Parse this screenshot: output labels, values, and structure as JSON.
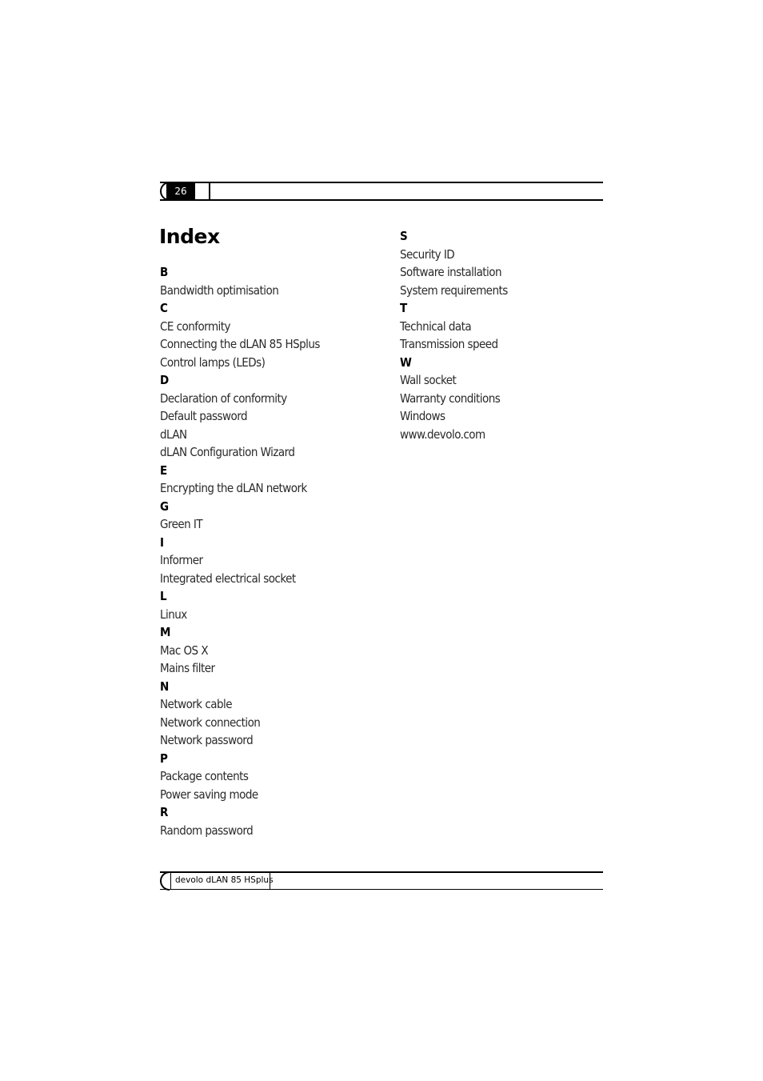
{
  "header": {
    "page_number": "26"
  },
  "title": "Index",
  "index": {
    "left_column": [
      {
        "letter": "B",
        "entries": [
          "Bandwidth optimisation"
        ]
      },
      {
        "letter": "C",
        "entries": [
          "CE conformity",
          "Connecting the dLAN 85 HSplus",
          "Control lamps (LEDs)"
        ]
      },
      {
        "letter": "D",
        "entries": [
          "Declaration of conformity",
          "Default password",
          "dLAN",
          "dLAN Configuration Wizard"
        ]
      },
      {
        "letter": "E",
        "entries": [
          "Encrypting the dLAN network"
        ]
      },
      {
        "letter": "G",
        "entries": [
          "Green IT"
        ]
      },
      {
        "letter": "I",
        "entries": [
          "Informer",
          "Integrated electrical socket"
        ]
      },
      {
        "letter": "L",
        "entries": [
          "Linux"
        ]
      },
      {
        "letter": "M",
        "entries": [
          "Mac OS X",
          "Mains filter"
        ]
      },
      {
        "letter": "N",
        "entries": [
          "Network cable",
          "Network connection",
          "Network password"
        ]
      },
      {
        "letter": "P",
        "entries": [
          "Package contents",
          "Power saving mode"
        ]
      },
      {
        "letter": "R",
        "entries": [
          "Random password"
        ]
      }
    ],
    "right_column": [
      {
        "letter": "S",
        "entries": [
          "Security ID",
          "Software installation",
          "System requirements"
        ]
      },
      {
        "letter": "T",
        "entries": [
          "Technical data",
          "Transmission speed"
        ]
      },
      {
        "letter": "W",
        "entries": [
          "Wall socket",
          "Warranty conditions",
          "Windows",
          "www.devolo.com"
        ]
      }
    ]
  },
  "footer": {
    "product_name": "devolo dLAN 85 HSplus"
  }
}
